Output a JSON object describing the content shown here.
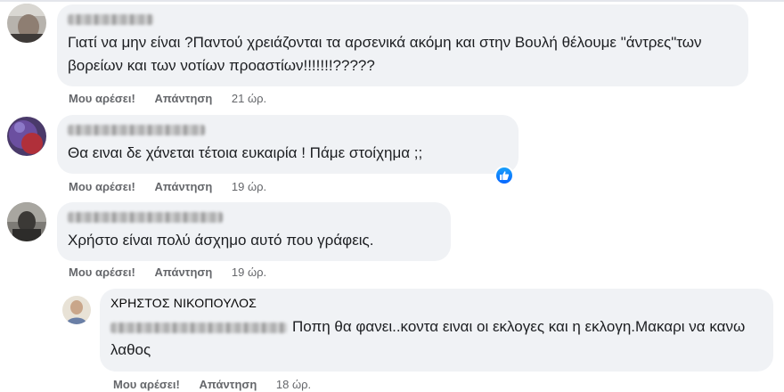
{
  "comments": [
    {
      "text": "Γιατί να μην είναι ?Παντού χρειάζονται τα αρσενικά ακόμη και στην Βουλή θέλουμε \"άντρες\"των βορείων και των νοτίων προαστίων!!!!!!!?????",
      "like_label": "Μου αρέσει!",
      "reply_label": "Απάντηση",
      "time": "21 ώρ."
    },
    {
      "text": "Θα ειναι δε χάνεται τέτοια ευκαιρία ! Πάμε στοίχημα ;;",
      "like_label": "Μου αρέσει!",
      "reply_label": "Απάντηση",
      "time": "19 ώρ.",
      "reaction_icon": "like-reaction-icon"
    },
    {
      "text": "Χρήστο είναι πολύ άσχημο αυτό που γράφεις.",
      "like_label": "Μου αρέσει!",
      "reply_label": "Απάντηση",
      "time": "19 ώρ."
    }
  ],
  "reply": {
    "author": "ΧΡΗΣΤΟΣ ΝΙΚΟΠΟΥΛΟΣ",
    "text": "Ποπη θα φανει..κοντα ειναι οι εκλογες και η εκλογη.Μακαρι να κανω λαθος",
    "like_label": "Μου αρέσει!",
    "reply_label": "Απάντηση",
    "time": "18 ώρ."
  },
  "colors": {
    "bubble": "#f0f2f5",
    "meta_text": "#65676b",
    "like_blue": "#0866ff"
  }
}
